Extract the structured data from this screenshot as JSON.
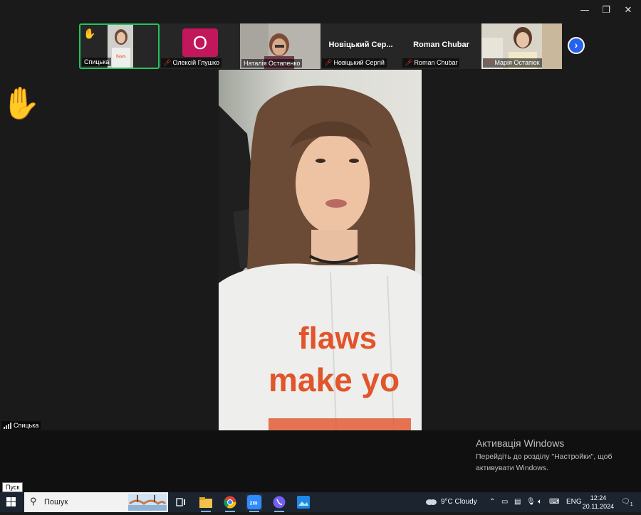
{
  "window": {
    "controls": {
      "minimize": "—",
      "maximize": "❐",
      "close": "✕"
    }
  },
  "gallery": {
    "tiles": [
      {
        "name": "Спицька",
        "active": true,
        "hand_raised": true,
        "muted": false
      },
      {
        "name": "Олексій Глушко",
        "avatar_letter": "O",
        "avatar_color": "#c2185b",
        "muted": true
      },
      {
        "name": "Наталія Остапенко",
        "muted": false
      },
      {
        "name": "Новіцький Сергій",
        "display": "Новіцький  Сер...",
        "muted": true
      },
      {
        "name": "Roman Chubar",
        "display": "Roman Chubar",
        "muted": true
      },
      {
        "name": "Марія Остапюк",
        "muted": true
      }
    ],
    "next_icon": "chevron-right-icon"
  },
  "main": {
    "hand_icon": "raised-hand-icon",
    "speaker_name": "Спицька",
    "shirt_lines": [
      "flaws",
      "make yo"
    ]
  },
  "activation": {
    "title": "Активація Windows",
    "text": "Перейдіть до розділу \"Настройки\", щоб активувати Windows."
  },
  "tooltip": "Пуск",
  "taskbar": {
    "search_placeholder": "Пошук",
    "weather": "9°C  Cloudy",
    "lang": "ENG",
    "time": "12:24",
    "date": "20.11.2024",
    "notif_count": "1"
  }
}
